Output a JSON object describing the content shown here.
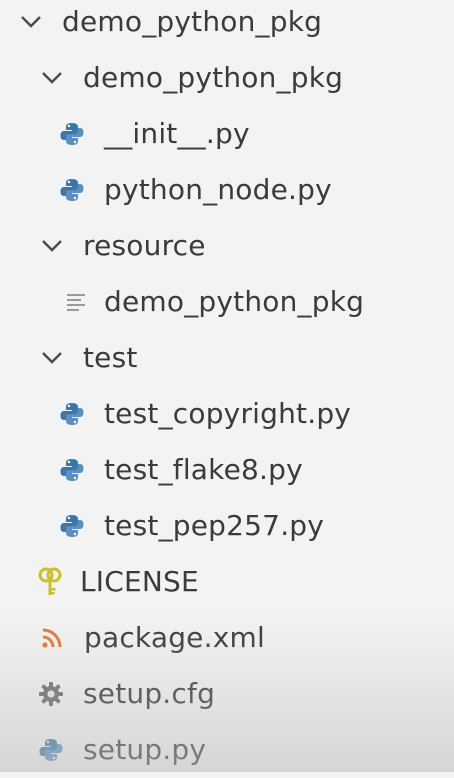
{
  "explorer": {
    "items": [
      {
        "label": "demo_python_pkg",
        "kind": "folder",
        "state": "expanded",
        "icon": "chevron-down-icon"
      },
      {
        "label": "demo_python_pkg",
        "kind": "folder",
        "state": "expanded",
        "icon": "chevron-down-icon"
      },
      {
        "label": "__init__.py",
        "kind": "file",
        "icon": "python-file-icon"
      },
      {
        "label": "python_node.py",
        "kind": "file",
        "icon": "python-file-icon"
      },
      {
        "label": "resource",
        "kind": "folder",
        "state": "expanded",
        "icon": "chevron-down-icon"
      },
      {
        "label": "demo_python_pkg",
        "kind": "file",
        "icon": "text-file-icon"
      },
      {
        "label": "test",
        "kind": "folder",
        "state": "expanded",
        "icon": "chevron-down-icon"
      },
      {
        "label": "test_copyright.py",
        "kind": "file",
        "icon": "python-file-icon"
      },
      {
        "label": "test_flake8.py",
        "kind": "file",
        "icon": "python-file-icon"
      },
      {
        "label": "test_pep257.py",
        "kind": "file",
        "icon": "python-file-icon"
      },
      {
        "label": "LICENSE",
        "kind": "file",
        "icon": "license-key-icon"
      },
      {
        "label": "package.xml",
        "kind": "file",
        "icon": "rss-icon"
      },
      {
        "label": "setup.cfg",
        "kind": "file",
        "icon": "gear-icon"
      },
      {
        "label": "setup.py",
        "kind": "file",
        "icon": "python-file-icon"
      }
    ]
  },
  "colors": {
    "python_blue": "#3b77a8",
    "python_yellow": "#f0c43a",
    "license_yellow": "#c9c030",
    "rss_orange": "#e37933",
    "gear_gray": "#6b6b6b",
    "text_icon_gray": "#9a9a9a"
  }
}
